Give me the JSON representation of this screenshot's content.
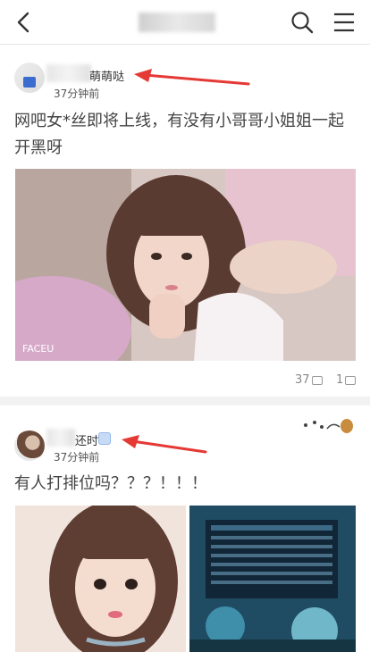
{
  "header": {
    "back_icon": "chevron-left-icon",
    "search_icon": "search-icon",
    "menu_icon": "menu-icon"
  },
  "posts": [
    {
      "author_name": "萌萌哒",
      "time": "37分钟前",
      "text": "网吧女*丝即将上线，有没有小哥哥小姐姐一起开黑呀",
      "image_watermark": "FACEU",
      "likes": "37",
      "comments": "1"
    },
    {
      "author_name": "还时",
      "time": "37分钟前",
      "text": "有人打排位吗？？？！！！"
    }
  ],
  "colors": {
    "arrow": "#e53935",
    "divider": "#f2f2f2"
  }
}
